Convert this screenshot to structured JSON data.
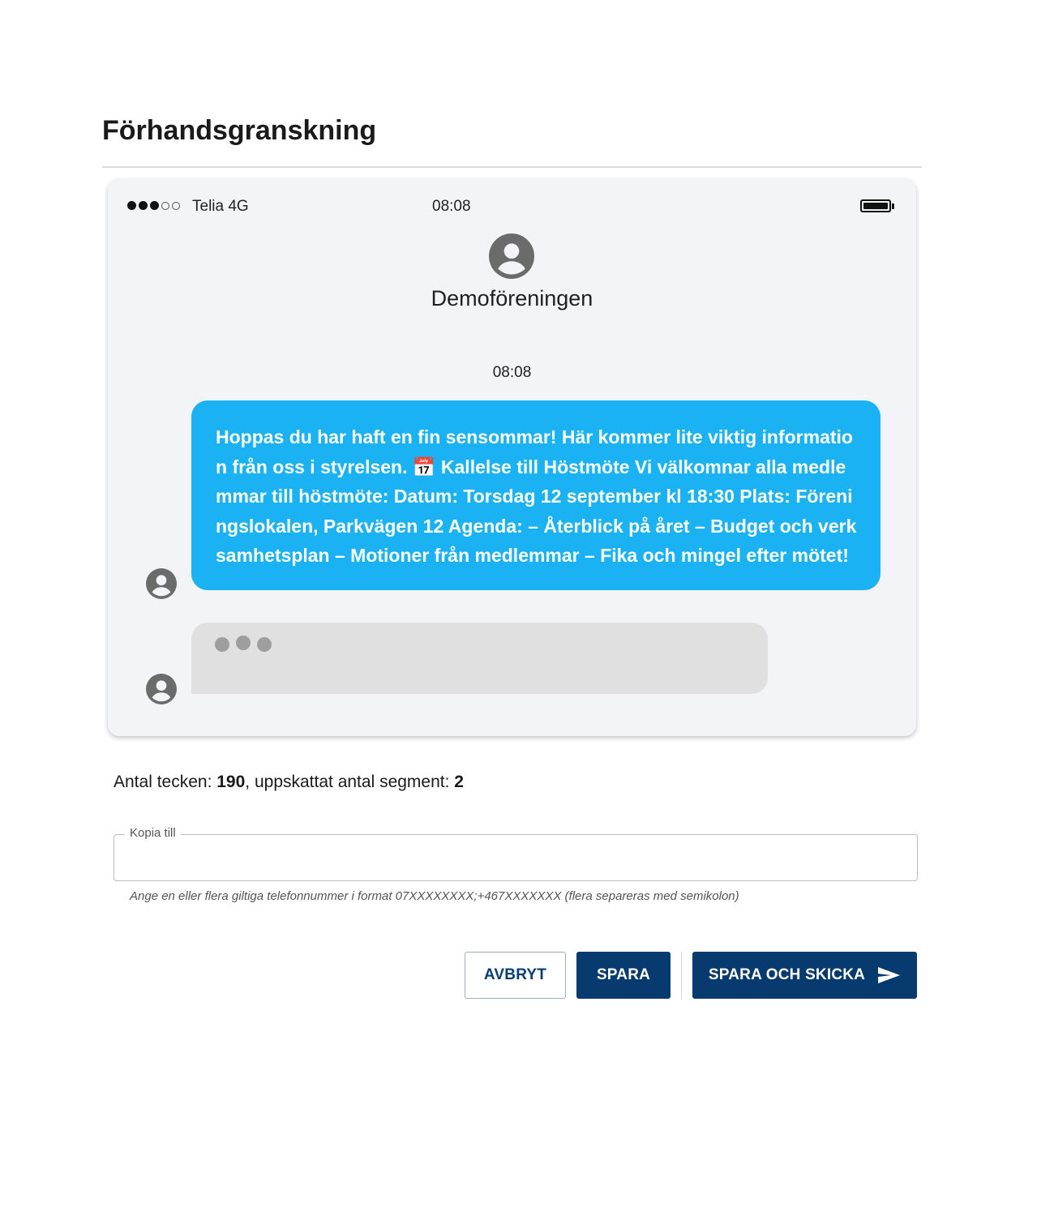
{
  "page": {
    "title": "Förhandsgranskning"
  },
  "phone": {
    "carrier": "Telia 4G",
    "clock": "08:08",
    "contact_name": "Demoföreningen",
    "message_time": "08:08",
    "message_text": "Hoppas du har haft en fin sensommar! Här kommer lite viktig information från oss i styrelsen. 📅 Kallelse till Höstmöte Vi välkomnar alla medlemmar till höstmöte: Datum: Torsdag 12 september kl 18:30 Plats: Föreningslokalen, Parkvägen 12 Agenda: – Återblick på året – Budget och verksamhetsplan – Motioner från medlemmar – Fika och mingel efter mötet!",
    "bubble_color": "#1ab2f3"
  },
  "stats": {
    "chars_label": "Antal tecken: ",
    "chars_value": "190",
    "segments_label": ", uppskattat antal segment: ",
    "segments_value": "2"
  },
  "copy_field": {
    "label": "Kopia till",
    "value": "",
    "help": "Ange en eller flera giltiga telefonnummer i format 07XXXXXXXX;+467XXXXXXX (flera separeras med semikolon)"
  },
  "actions": {
    "cancel_label": "AVBRYT",
    "save_label": "SPARA",
    "save_send_label": "SPARA OCH SKICKA",
    "primary_color": "#073a6e"
  }
}
